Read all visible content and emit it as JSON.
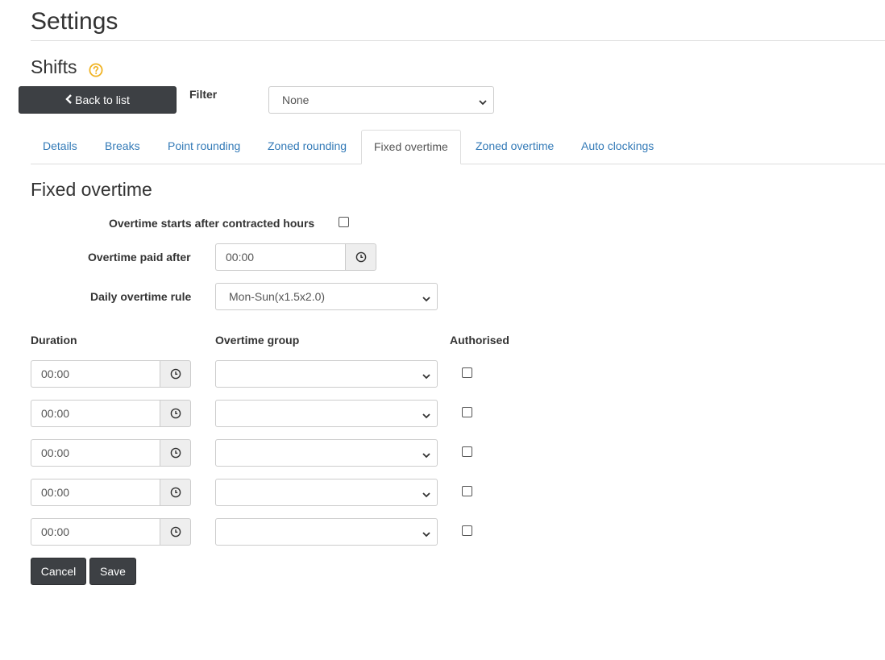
{
  "header": {
    "title": "Settings",
    "section": "Shifts",
    "help_icon": "question-circle-icon"
  },
  "toolbar": {
    "back_label": "Back to list",
    "filter_label": "Filter",
    "filter_value": "None"
  },
  "tabs": [
    {
      "label": "Details",
      "active": false
    },
    {
      "label": "Breaks",
      "active": false
    },
    {
      "label": "Point rounding",
      "active": false
    },
    {
      "label": "Zoned rounding",
      "active": false
    },
    {
      "label": "Fixed overtime",
      "active": true
    },
    {
      "label": "Zoned overtime",
      "active": false
    },
    {
      "label": "Auto clockings",
      "active": false
    }
  ],
  "form": {
    "title": "Fixed overtime",
    "starts_after_label": "Overtime starts after contracted hours",
    "starts_after_checked": false,
    "paid_after_label": "Overtime paid after",
    "paid_after_value": "00:00",
    "daily_rule_label": "Daily overtime rule",
    "daily_rule_value": "Mon-Sun(x1.5x2.0)"
  },
  "table": {
    "headers": {
      "duration": "Duration",
      "group": "Overtime group",
      "authorised": "Authorised"
    },
    "rows": [
      {
        "duration": "00:00",
        "group": "",
        "authorised": false
      },
      {
        "duration": "00:00",
        "group": "",
        "authorised": false
      },
      {
        "duration": "00:00",
        "group": "",
        "authorised": false
      },
      {
        "duration": "00:00",
        "group": "",
        "authorised": false
      },
      {
        "duration": "00:00",
        "group": "",
        "authorised": false
      }
    ]
  },
  "actions": {
    "cancel_label": "Cancel",
    "save_label": "Save"
  },
  "colors": {
    "accent_link": "#337ab7",
    "button_dark": "#3d4044",
    "help_icon": "#f0b323"
  }
}
